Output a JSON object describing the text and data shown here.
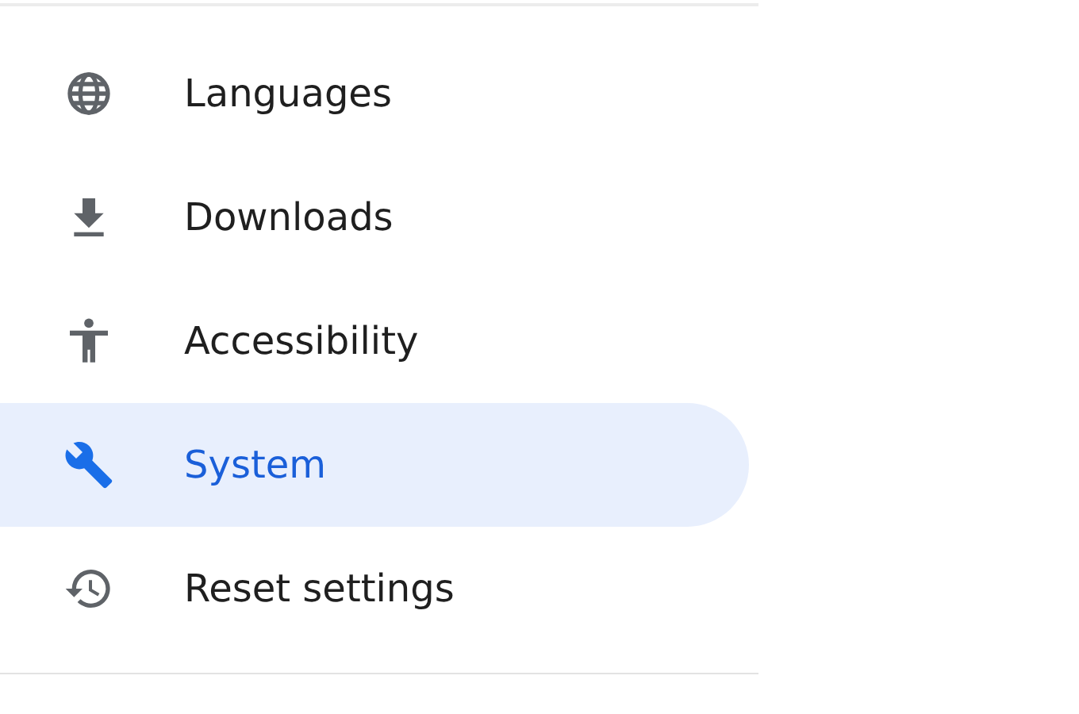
{
  "menu": {
    "items": [
      {
        "label": "Languages",
        "selected": false
      },
      {
        "label": "Downloads",
        "selected": false
      },
      {
        "label": "Accessibility",
        "selected": false
      },
      {
        "label": "System",
        "selected": true
      },
      {
        "label": "Reset settings",
        "selected": false
      }
    ]
  }
}
